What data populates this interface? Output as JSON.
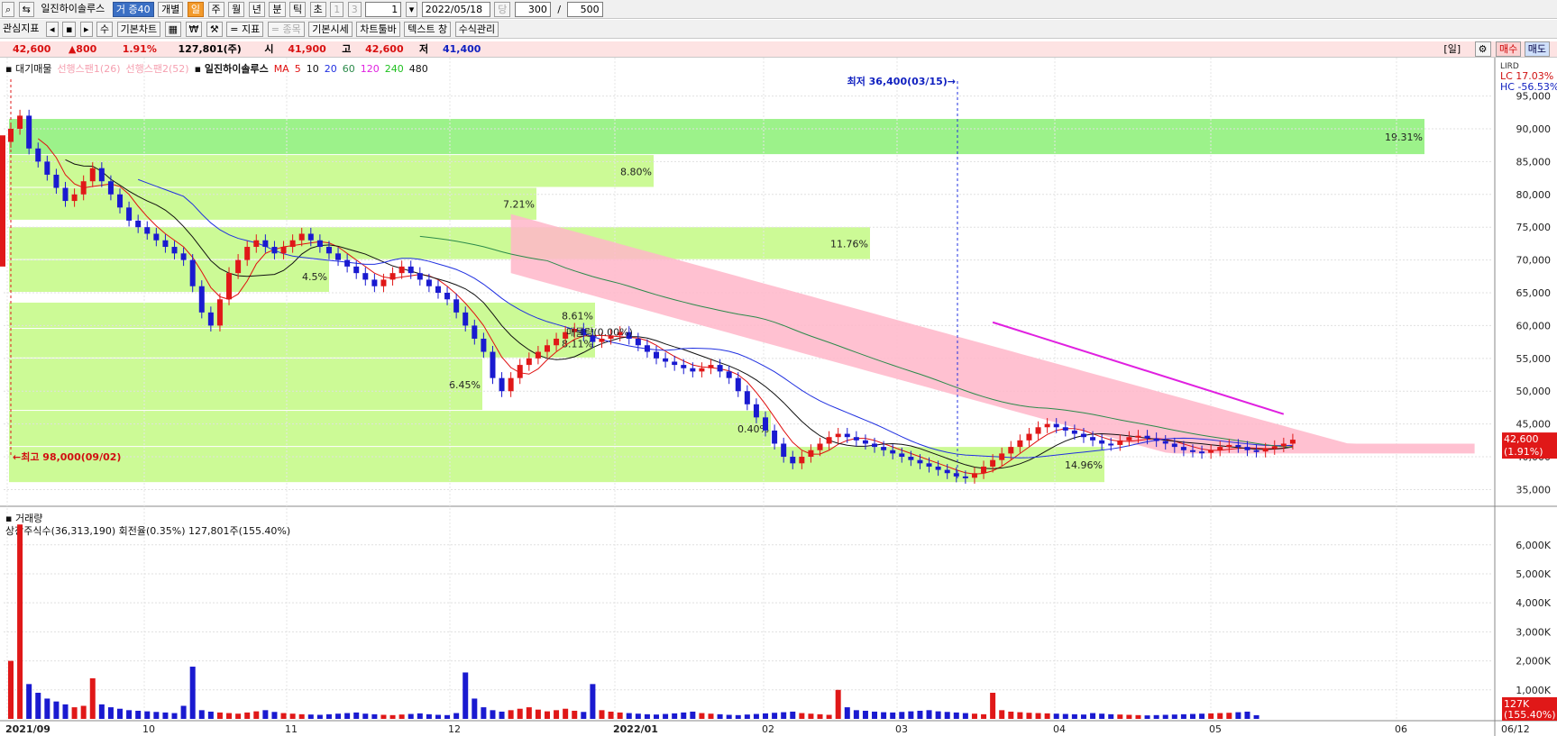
{
  "toolbar1": {
    "stock_name": "일진하이솔루스",
    "badge": "거 증40",
    "buttons": [
      "개별",
      "일",
      "주",
      "월",
      "년",
      "분",
      "틱",
      "초"
    ],
    "active": "일",
    "num1": "1",
    "num3": "3",
    "period": "1",
    "date": "2022/05/18",
    "count_label": "당",
    "count": "300",
    "slash": "/",
    "total": "500"
  },
  "toolbar2": {
    "items": [
      "관심지표",
      "◂",
      "▪",
      "▸",
      "수",
      "기본차트",
      "▦",
      "₩",
      "⚒",
      "= 지표",
      "= 종목",
      "기본시세",
      "차트툴바",
      "텍스트 창",
      "수식관리"
    ]
  },
  "info": {
    "price": "42,600",
    "change": "▲800",
    "rate": "1.91%",
    "volume": "127,801(주)",
    "open_label": "시",
    "open": "41,900",
    "high_label": "고",
    "high": "42,600",
    "low_label": "저",
    "low": "41,400",
    "period_tag": "[일]",
    "buy": "매수",
    "sell": "매도"
  },
  "legend": {
    "title": "대기매물",
    "span1": "선행스팬1(26)",
    "span2": "선행스팬2(52)",
    "name": "일진하이솔루스",
    "ma_label": "MA",
    "mas": [
      "5",
      "10",
      "20",
      "60",
      "120",
      "240",
      "480"
    ]
  },
  "lcrd": "LIRD",
  "lc": "LC  17.03%",
  "hc": "HC -56.53%",
  "volume_legend": {
    "title": "거래량",
    "detail": "상장주식수(36,313,190) 회전율(0.35%) 127,801주(155.40%)"
  },
  "chart_data": {
    "type": "candlestick",
    "price_ticks": [
      "95,000",
      "90,000",
      "85,000",
      "80,000",
      "75,000",
      "70,000",
      "65,000",
      "60,000",
      "55,000",
      "50,000",
      "45,000",
      "40,000",
      "35,000"
    ],
    "volume_ticks": [
      "6,000K",
      "5,000K",
      "4,000K",
      "3,000K",
      "2,000K",
      "1,000K"
    ],
    "x_labels": [
      "2021/09",
      "10",
      "11",
      "12",
      "2022/01",
      "02",
      "03",
      "04",
      "05",
      "06",
      "06/12"
    ],
    "price_ylim": [
      33000,
      97000
    ],
    "volume_ylim": [
      0,
      6800
    ],
    "current_price_tag": "42,600",
    "current_rate_tag": "(1.91%)",
    "current_volume_tag": "127K",
    "current_volume_rate_tag": "(155.40%)",
    "annotations": {
      "high": "←최고 98,000(09/02)",
      "low": "최저 36,400(03/15)→"
    },
    "supply_bands": [
      {
        "low": 86000,
        "high": 91500,
        "pct": "19.31%"
      },
      {
        "low": 81000,
        "high": 86000,
        "pct": "8.80%"
      },
      {
        "low": 76000,
        "high": 81000,
        "pct": "7.21%"
      },
      {
        "low": 70000,
        "high": 75000,
        "pct": "11.76%"
      },
      {
        "low": 65000,
        "high": 70000,
        "pct": "4.5%"
      },
      {
        "low": 59500,
        "high": 63500,
        "pct": "8.61%"
      },
      {
        "low": 55000,
        "high": 59500,
        "pct": "8.11%"
      },
      {
        "low": 47000,
        "high": 55000,
        "pct": "6.45%"
      },
      {
        "low": 41500,
        "high": 47000,
        "pct": "0.40%"
      },
      {
        "low": 36000,
        "high": 41500,
        "pct": "14.96%"
      }
    ],
    "volume_peak_label": "매물량(0.00%)",
    "closes": [
      90000,
      92000,
      87000,
      85000,
      83000,
      81000,
      79000,
      80000,
      82000,
      84000,
      82000,
      80000,
      78000,
      76000,
      75000,
      74000,
      73000,
      72000,
      71000,
      70000,
      66000,
      62000,
      60000,
      64000,
      68000,
      70000,
      72000,
      73000,
      72000,
      71000,
      72000,
      73000,
      74000,
      73000,
      72000,
      71000,
      70000,
      69000,
      68000,
      67000,
      66000,
      67000,
      68000,
      69000,
      68000,
      67000,
      66000,
      65000,
      64000,
      62000,
      60000,
      58000,
      56000,
      52000,
      50000,
      52000,
      54000,
      55000,
      56000,
      57000,
      58000,
      59000,
      59500,
      58500,
      57500,
      58000,
      58500,
      59000,
      58000,
      57000,
      56000,
      55000,
      54500,
      54000,
      53500,
      53000,
      53500,
      54000,
      53000,
      52000,
      50000,
      48000,
      46000,
      44000,
      42000,
      40000,
      39000,
      40000,
      41000,
      42000,
      43000,
      43500,
      43000,
      42500,
      42000,
      41500,
      41000,
      40500,
      40000,
      39500,
      39000,
      38500,
      38000,
      37500,
      37000,
      36800,
      37500,
      38500,
      39500,
      40500,
      41500,
      42500,
      43500,
      44500,
      45000,
      44500,
      44000,
      43500,
      43000,
      42500,
      42000,
      41800,
      42500,
      43000,
      43200,
      42800,
      42400,
      42000,
      41500,
      41000,
      40800,
      40600,
      41000,
      41500,
      41800,
      41500,
      41000,
      40800,
      41200,
      41600,
      42000,
      42600
    ],
    "volumes": [
      2000,
      6700,
      1200,
      900,
      700,
      600,
      500,
      400,
      450,
      1400,
      500,
      400,
      350,
      300,
      280,
      260,
      240,
      220,
      200,
      450,
      1800,
      300,
      250,
      220,
      200,
      180,
      220,
      260,
      300,
      240,
      200,
      180,
      160,
      150,
      140,
      160,
      180,
      200,
      220,
      180,
      160,
      140,
      130,
      150,
      170,
      190,
      160,
      140,
      130,
      200,
      1600,
      700,
      400,
      300,
      250,
      300,
      350,
      400,
      320,
      260,
      300,
      350,
      280,
      240,
      1200,
      300,
      250,
      220,
      200,
      180,
      160,
      150,
      170,
      190,
      220,
      250,
      200,
      180,
      160,
      140,
      130,
      150,
      170,
      190,
      210,
      230,
      250,
      200,
      180,
      160,
      140,
      1000,
      400,
      300,
      280,
      250,
      230,
      220,
      240,
      260,
      280,
      300,
      260,
      240,
      220,
      200,
      180,
      160,
      900,
      300,
      250,
      230,
      210,
      200,
      190,
      180,
      170,
      160,
      150,
      200,
      180,
      160,
      150,
      140,
      130,
      120,
      130,
      140,
      150,
      160,
      170,
      180,
      190,
      200,
      210,
      230,
      250,
      127
    ]
  }
}
